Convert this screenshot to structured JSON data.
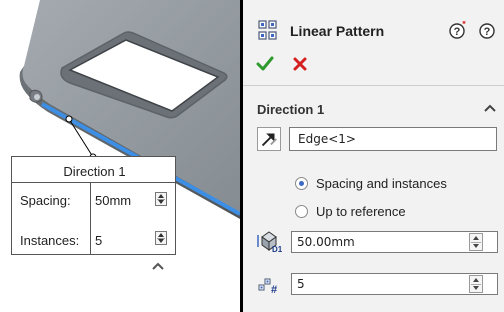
{
  "viewport": {
    "callout": {
      "title": "Direction 1",
      "spacing_label": "Spacing:",
      "spacing_value": "50mm",
      "instances_label": "Instances:",
      "instances_value": "5"
    }
  },
  "panel": {
    "title": "Linear Pattern",
    "section": {
      "header": "Direction 1",
      "edge_reference": "Edge<1>",
      "options": [
        {
          "label": "Spacing and instances",
          "selected": true
        },
        {
          "label": "Up to reference",
          "selected": false
        }
      ],
      "spacing_value": "50.00mm",
      "instances_value": "5"
    }
  },
  "icons": {
    "ok": "checkmark-icon",
    "cancel": "x-icon",
    "help": "help-icon",
    "feature": "linear-pattern-icon"
  },
  "colors": {
    "ok_green": "#2e9a2e",
    "cancel_red": "#d42020",
    "part_gray": "#8f969c",
    "edge_blue": "#3d8fe6",
    "radio_blue": "#3d67c4"
  }
}
